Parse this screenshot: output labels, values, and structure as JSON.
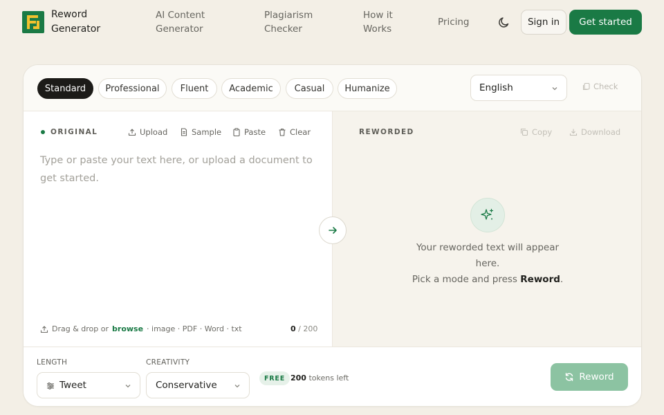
{
  "brand": {
    "line1": "Reword",
    "line2": "Generator",
    "logo_color": "#1a7a45",
    "logo_accent": "#f2c12e"
  },
  "nav": [
    {
      "line1": "AI Content",
      "line2": "Generator"
    },
    {
      "line1": "Plagiarism",
      "line2": "Checker"
    },
    {
      "line1": "How it",
      "line2": "Works"
    },
    {
      "line1": "Pricing",
      "line2": ""
    }
  ],
  "header": {
    "theme_icon": "moon-icon",
    "signin_label": "Sign in",
    "get_started_label": "Get started"
  },
  "modes": [
    {
      "label": "Standard",
      "active": true
    },
    {
      "label": "Professional",
      "active": false
    },
    {
      "label": "Fluent",
      "active": false
    },
    {
      "label": "Academic",
      "active": false
    },
    {
      "label": "Casual",
      "active": false
    },
    {
      "label": "Humanize",
      "active": false
    }
  ],
  "language": {
    "selected": "English"
  },
  "check_label": "Check",
  "original": {
    "label": "ORIGINAL",
    "tools": {
      "upload": "Upload",
      "sample": "Sample",
      "paste": "Paste",
      "clear": "Clear"
    },
    "placeholder": "Type or paste your text here, or upload a document to get started.",
    "drop_prefix": "Drag & drop or",
    "drop_browse": "browse",
    "drop_suffix": "· image · PDF · Word · txt",
    "count": "0",
    "max": "/ 200"
  },
  "reworded": {
    "label": "REWORDED",
    "copy_label": "Copy",
    "download_label": "Download",
    "empty_line1a": "Your reworded text will appear",
    "empty_line1b": "here.",
    "empty_line2_prefix": "Pick a mode and press",
    "empty_line2_bold": "Reword",
    "empty_line2_suffix": "."
  },
  "length": {
    "label": "LENGTH",
    "value": "Tweet"
  },
  "creativity": {
    "label": "CREATIVITY",
    "value": "Conservative"
  },
  "plan": {
    "badge": "FREE",
    "tokens": "200",
    "tokens_suffix": "tokens left"
  },
  "reword_label": "Reword",
  "colors": {
    "accent": "#1a7a45",
    "background": "#f3efe6",
    "disabled_accent": "#8cc3a2"
  }
}
